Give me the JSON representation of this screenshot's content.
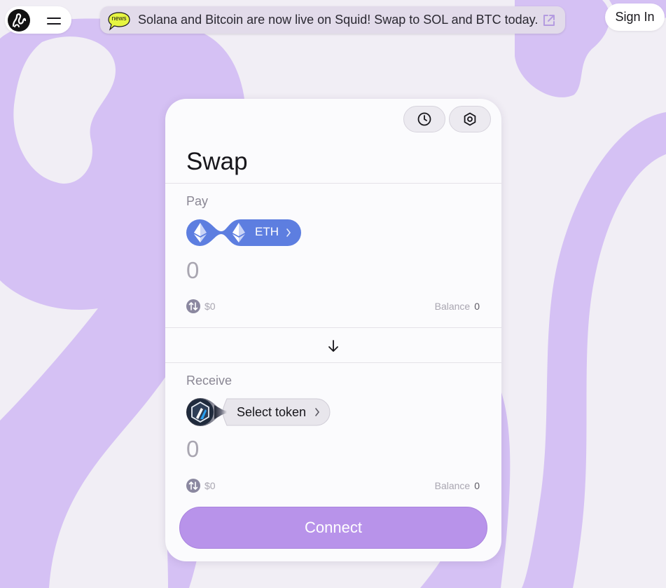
{
  "header": {
    "news_badge": "news",
    "announcement": "Solana and Bitcoin are now live on Squid! Swap to SOL and BTC today.",
    "sign_in_label": "Sign In"
  },
  "swap": {
    "title": "Swap",
    "pay": {
      "label": "Pay",
      "token": "ETH",
      "amount": "0",
      "usd_value": "$0",
      "balance_label": "Balance",
      "balance_value": "0"
    },
    "receive": {
      "label": "Receive",
      "token_placeholder": "Select token",
      "amount": "0",
      "usd_value": "$0",
      "balance_label": "Balance",
      "balance_value": "0"
    },
    "connect_label": "Connect"
  },
  "colors": {
    "accent": "#b893ea",
    "background": "#f1eef5",
    "blob": "#d5c1f4",
    "eth_pill": "#5d7ee0",
    "news_badge": "#e6f542"
  },
  "icons": [
    "squid-logo-icon",
    "menu-icon",
    "external-link-icon",
    "history-icon",
    "settings-icon",
    "ethereum-icon",
    "arbitrum-icon",
    "chevron-right-icon",
    "arrow-down-icon",
    "usd-toggle-icon"
  ]
}
